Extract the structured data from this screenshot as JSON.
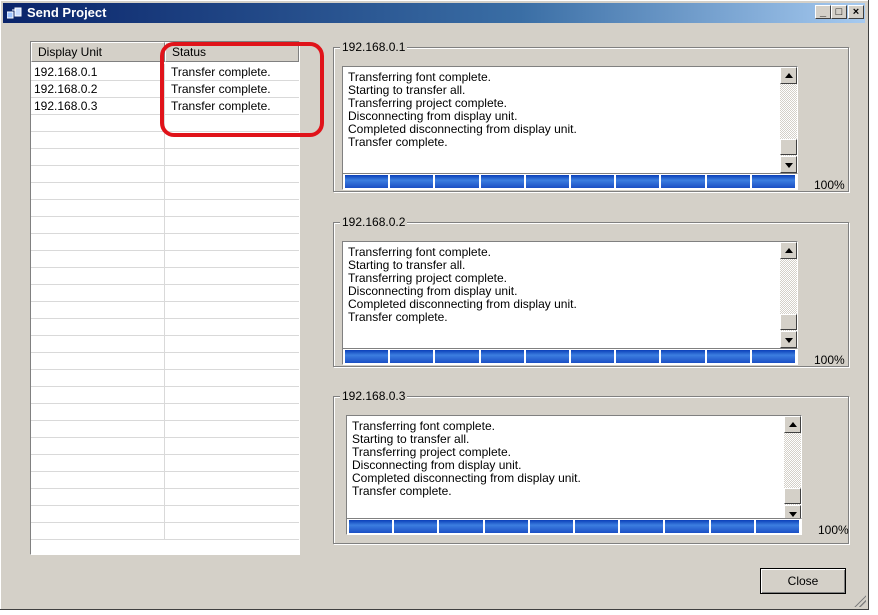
{
  "window": {
    "title": "Send Project",
    "minimize_glyph": "_",
    "maximize_glyph": "□",
    "close_glyph": "×"
  },
  "units_table": {
    "columns": [
      "Display Unit",
      "Status"
    ],
    "rows": [
      {
        "unit": "192.168.0.1",
        "status": "Transfer complete."
      },
      {
        "unit": "192.168.0.2",
        "status": "Transfer complete."
      },
      {
        "unit": "192.168.0.3",
        "status": "Transfer complete."
      }
    ]
  },
  "transfers": [
    {
      "label": "192.168.0.1",
      "log": [
        "Transferring font complete.",
        "Starting to transfer all.",
        "Transferring project complete.",
        "Disconnecting from display unit.",
        "Completed disconnecting from display unit.",
        "Transfer complete."
      ],
      "progress_percent": 100,
      "progress_text": "100%"
    },
    {
      "label": "192.168.0.2",
      "log": [
        "Transferring font complete.",
        "Starting to transfer all.",
        "Transferring project complete.",
        "Disconnecting from display unit.",
        "Completed disconnecting from display unit.",
        "Transfer complete."
      ],
      "progress_percent": 100,
      "progress_text": "100%"
    },
    {
      "label": "192.168.0.3",
      "log": [
        "Transferring font complete.",
        "Starting to transfer all.",
        "Transferring project complete.",
        "Disconnecting from display unit.",
        "Completed disconnecting from display unit.",
        "Transfer complete."
      ],
      "progress_percent": 100,
      "progress_text": "100%"
    }
  ],
  "buttons": {
    "close_label": "Close"
  },
  "colors": {
    "highlight": "#e0131a",
    "progress_fill": "#1b4fc4",
    "titlebar": "#0a246a"
  }
}
